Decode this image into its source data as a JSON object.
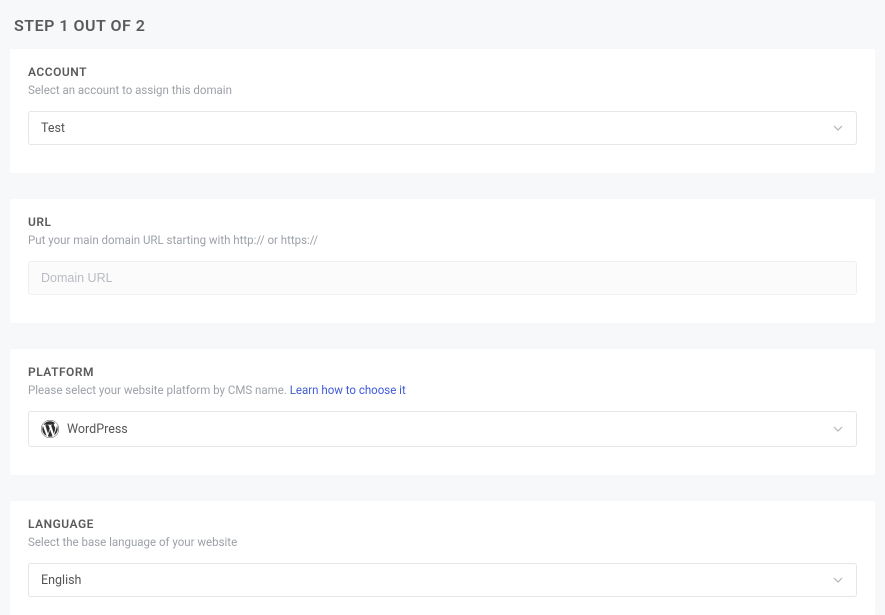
{
  "header": {
    "step_title": "STEP 1 OUT OF 2"
  },
  "account": {
    "title": "ACCOUNT",
    "subtitle": "Select an account to assign this domain",
    "selected": "Test"
  },
  "url": {
    "title": "URL",
    "subtitle": "Put your main domain URL starting with http:// or https://",
    "placeholder": "Domain URL",
    "value": ""
  },
  "platform": {
    "title": "PLATFORM",
    "subtitle_prefix": "Please select your website platform by CMS name.  ",
    "learn_link": "Learn how to choose it",
    "selected": "WordPress"
  },
  "language": {
    "title": "LANGUAGE",
    "subtitle": "Select the base language of your website",
    "selected": "English"
  }
}
